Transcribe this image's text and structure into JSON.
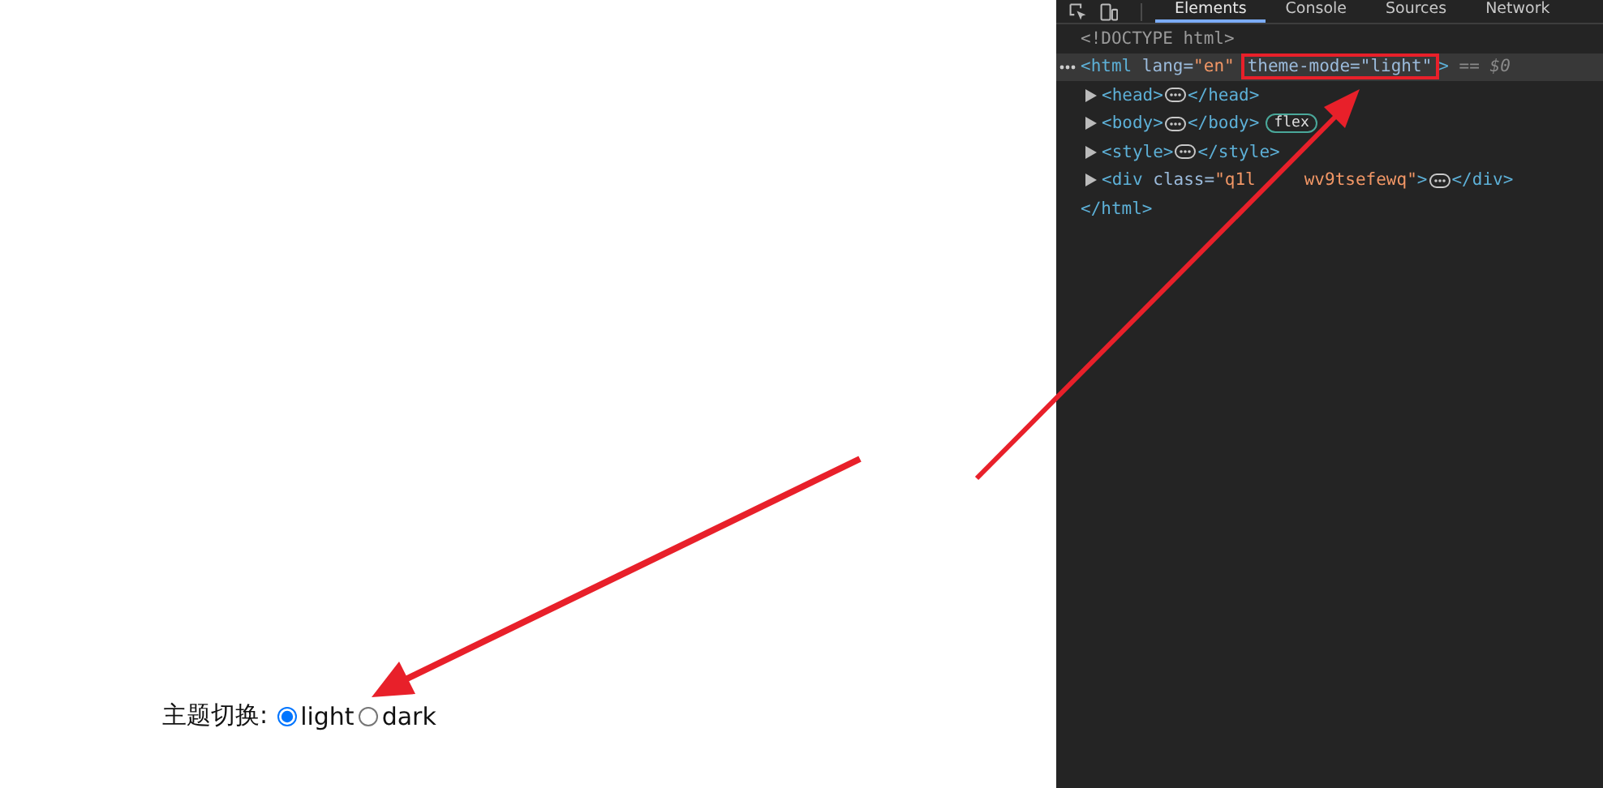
{
  "page": {
    "label": "主题切换:",
    "options": [
      {
        "label": "light",
        "selected": true
      },
      {
        "label": "dark",
        "selected": false
      }
    ]
  },
  "devtools": {
    "tabs": [
      {
        "label": "Elements",
        "selected": true
      },
      {
        "label": "Console",
        "selected": false
      },
      {
        "label": "Sources",
        "selected": false
      },
      {
        "label": "Network",
        "selected": false
      }
    ],
    "dom": [
      {
        "selected": false,
        "tokens": [
          {
            "kind": "comment",
            "text": "<!DOCTYPE html>"
          }
        ]
      },
      {
        "selected": true,
        "tokens": [
          {
            "kind": "tag",
            "text": "<html"
          },
          {
            "kind": "attr",
            "text": " lang="
          },
          {
            "kind": "val",
            "text": "\"en\""
          },
          {
            "kind": "box",
            "tokens": [
              {
                "kind": "attr",
                "text": "theme-mode="
              },
              {
                "kind": "attr",
                "text": "\"light\""
              }
            ]
          },
          {
            "kind": "tag",
            "text": ">"
          },
          {
            "kind": "ref",
            "text": " == $0"
          }
        ],
        "children": [
          {
            "expanded": false,
            "tokens": [
              {
                "kind": "tag",
                "text": "<head>"
              },
              {
                "kind": "dots"
              },
              {
                "kind": "tag",
                "text": "</head>"
              }
            ]
          },
          {
            "expanded": false,
            "tokens": [
              {
                "kind": "tag",
                "text": "<body>"
              },
              {
                "kind": "dots"
              },
              {
                "kind": "tag",
                "text": "</body>"
              },
              {
                "kind": "badge",
                "text": "flex"
              }
            ]
          },
          {
            "expanded": false,
            "tokens": [
              {
                "kind": "tag",
                "text": "<style>"
              },
              {
                "kind": "dots"
              },
              {
                "kind": "tag",
                "text": "</style>"
              }
            ]
          },
          {
            "expanded": false,
            "tokens": [
              {
                "kind": "tag",
                "text": "<div"
              },
              {
                "kind": "attr",
                "text": " class="
              },
              {
                "kind": "val",
                "text": "\"q1l"
              },
              {
                "kind": "gap"
              },
              {
                "kind": "val",
                "text": "wv9tsefewq\""
              },
              {
                "kind": "tag",
                "text": ">"
              },
              {
                "kind": "dots"
              },
              {
                "kind": "tag",
                "text": "</div>"
              }
            ]
          }
        ],
        "close": [
          {
            "kind": "tag",
            "text": "</html>"
          }
        ]
      }
    ]
  }
}
